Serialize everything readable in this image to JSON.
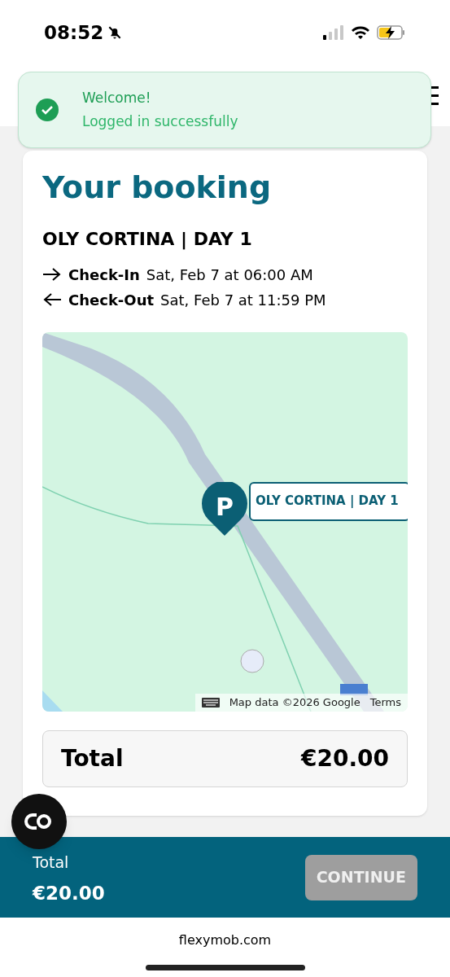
{
  "status_bar": {
    "time": "08:52"
  },
  "toast": {
    "title": "Welcome!",
    "message": "Logged in successfully"
  },
  "booking": {
    "title": "Your booking",
    "event": "OLY CORTINA | DAY 1",
    "times": [
      {
        "kind": "in",
        "label": "Check-In",
        "value": "Sat, Feb 7 at 06:00 AM"
      },
      {
        "kind": "out",
        "label": "Check-Out",
        "value": "Sat, Feb 7 at 11:59 PM"
      }
    ],
    "map": {
      "marker": {
        "letter": "P",
        "label": "OLY CORTINA | DAY 1"
      },
      "attribution": "Map data ©2026 Google",
      "terms": "Terms"
    },
    "total": {
      "label": "Total",
      "amount": "€20.00"
    }
  },
  "bottom_bar": {
    "label": "Total",
    "amount": "€20.00",
    "button": {
      "label": "CONTINUE",
      "disabled": true
    }
  },
  "browser": {
    "url": "flexymob.com"
  }
}
